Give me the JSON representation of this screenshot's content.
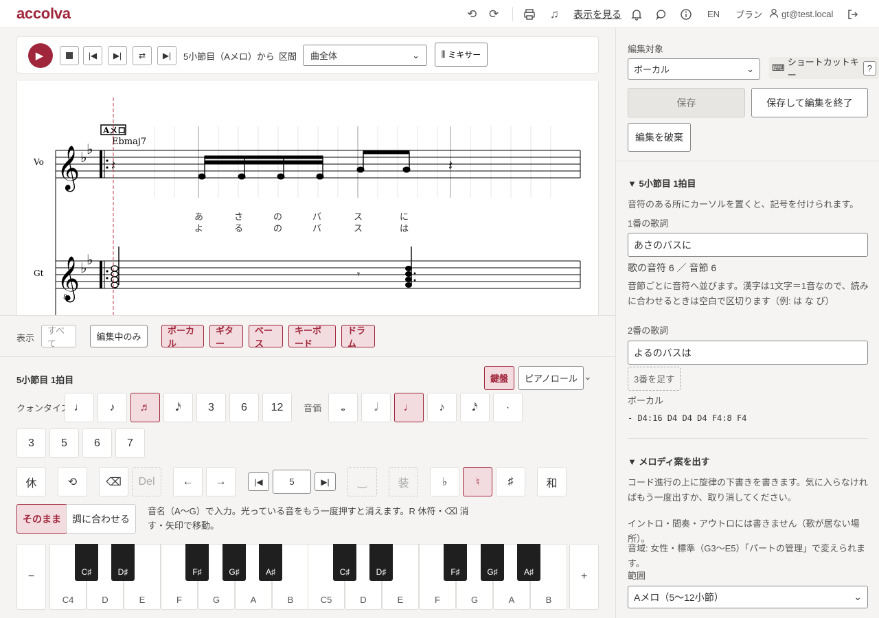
{
  "header": {
    "logo": "accolva",
    "view_link": "表示を見る",
    "lang": "EN",
    "plan": "プラン",
    "user": "gt@test.local"
  },
  "transport": {
    "position_text": "5小節目（Aメロ）から",
    "section_label": "区間",
    "section_value": "曲全体",
    "mixer_label": "ミキサー"
  },
  "score": {
    "rehearsal_mark": "Aメロ",
    "chord": "Ebmaj7",
    "vocal_label": "Vo",
    "guitar_label": "Gt",
    "lyrics_1": [
      "あ",
      "さ",
      "の",
      "バ",
      "ス",
      "に"
    ],
    "lyrics_2": [
      "よ",
      "る",
      "の",
      "バ",
      "ス",
      "は"
    ]
  },
  "display": {
    "label": "表示",
    "all": "すべて",
    "editing_only": "編集中のみ",
    "parts": [
      "ボーカル",
      "ギター",
      "ベース",
      "キーボード",
      "ドラム"
    ]
  },
  "editor": {
    "title": "5小節目 1拍目",
    "keyboard_tab": "鍵盤",
    "pianoroll_tab": "ピアノロール",
    "quantize_label": "クォンタイズ",
    "quantize_buttons": [
      "♩",
      "♪",
      "♬",
      "𝅘𝅥𝅯",
      "3",
      "6",
      "12"
    ],
    "note_value_label": "音価",
    "note_values": [
      "𝅝",
      "𝅗𝅥",
      "♩",
      "♪",
      "𝅘𝅥𝅯",
      "·"
    ],
    "tuplets": [
      "3",
      "5",
      "6",
      "7"
    ],
    "rest": "休",
    "undo_glyph": "⟲",
    "backspace_glyph": "⌫",
    "del": "Del",
    "left_arrow": "←",
    "right_arrow": "→",
    "octave_prev": "|◀",
    "octave_value": "5",
    "octave_next": "▶|",
    "tie": "‿",
    "ornament": "装",
    "flat": "♭",
    "natural": "♮",
    "sharp": "♯",
    "chord_btn": "和",
    "mode_asis": "そのまま",
    "mode_key": "調に合わせる",
    "help": "音名（A〜G）で入力。光っている音をもう一度押すと消えます。R 休符・⌫ 消す・矢印で移動。"
  },
  "piano": {
    "minus": "−",
    "plus": "+",
    "white_keys": [
      "C4",
      "D",
      "E",
      "F",
      "G",
      "A",
      "B",
      "C5",
      "D",
      "E",
      "F",
      "G",
      "A",
      "B"
    ],
    "black_keys": [
      "C♯",
      "D♯",
      "F♯",
      "G♯",
      "A♯",
      "C♯",
      "D♯",
      "F♯",
      "G♯",
      "A♯"
    ]
  },
  "sidebar": {
    "target_label": "編集対象",
    "target_value": "ボーカル",
    "shortcut_label": "ショートカットキー",
    "shortcut_help": "?",
    "save": "保存",
    "save_exit": "保存して編集を終了",
    "discard": "編集を破棄",
    "sec1_title": "▼ 5小節目 1拍目",
    "sec1_hint": "音符のある所にカーソルを置くと、記号を付けられます。",
    "lyric1_label": "1番の歌詞",
    "lyric1_value": "あさのバスに",
    "count_text": "歌の音符 6 ／ 音節 6",
    "count_help": "音節ごとに音符へ並びます。漢字は1文字＝1音なので、読みに合わせるときは空白で区切ります（例: は な び）",
    "lyric2_label": "2番の歌詞",
    "lyric2_value": "よるのバスは",
    "add_verse": "3番を足す",
    "part_label": "ボーカル",
    "notes_text": "- D4:16 D4 D4 D4 F4:8 F4",
    "sec2_title": "▼ メロディ案を出す",
    "sec2_p1": "コード進行の上に旋律の下書きを書きます。気に入らなければもう一度出すか、取り消してください。",
    "sec2_p2": "イントロ・間奏・アウトロには書きません（歌が居ない場所）。",
    "sec2_p3": "音域: 女性・標準（G3〜E5）「パートの管理」で変えられます。",
    "range_label": "範囲",
    "range_value": "Aメロ（5〜12小節）"
  },
  "colors": {
    "accent": "#a0263c",
    "accent_bg": "#f3dcdf"
  }
}
